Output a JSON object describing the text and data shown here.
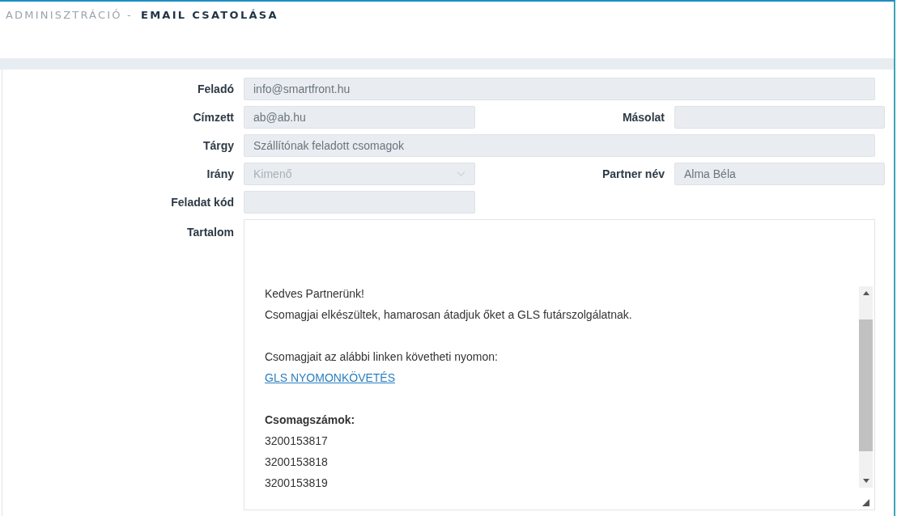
{
  "header": {
    "section": "ADMINISZTRÁCIÓ -",
    "title": "EMAIL CSATOLÁSA"
  },
  "rows": [
    {
      "kind": "wide",
      "fields": [
        {
          "kind": "text",
          "label": "Feladó",
          "value": "info@smartfront.hu"
        }
      ]
    },
    {
      "kind": "pair",
      "fields": [
        {
          "kind": "text",
          "label": "Címzett",
          "value": "ab@ab.hu"
        },
        {
          "kind": "text",
          "label": "Másolat"
        }
      ]
    },
    {
      "kind": "wide",
      "fields": [
        {
          "kind": "text",
          "label": "Tárgy",
          "value": "Szállítónak feladott csomagok"
        }
      ]
    },
    {
      "kind": "pair",
      "fields": [
        {
          "kind": "select",
          "label": "Irány",
          "value": "Kimenő",
          "disabled": true
        },
        {
          "kind": "text",
          "label": "Partner név",
          "value": "Alma Béla"
        }
      ]
    },
    {
      "kind": "pair",
      "fields": [
        {
          "kind": "text",
          "label": "Feladat kód"
        }
      ]
    }
  ],
  "content": {
    "label": "Tartalom",
    "blocks": [
      {
        "lines": [
          {
            "kind": "text",
            "text": "Kedves Partnerünk!"
          },
          {
            "kind": "text",
            "text": "Csomagjai elkészültek, hamarosan átadjuk őket a GLS futárszolgálatnak."
          }
        ]
      },
      {
        "lines": [
          {
            "kind": "text",
            "text": "Csomagjait az alábbi linken követheti nyomon:"
          },
          {
            "kind": "link",
            "text": "GLS NYOMONKÖVETÉS"
          }
        ]
      },
      {
        "lines": [
          {
            "kind": "bold",
            "text": "Csomagszámok:"
          },
          {
            "kind": "text",
            "text": "3200153817"
          },
          {
            "kind": "text",
            "text": "3200153818"
          },
          {
            "kind": "text",
            "text": "3200153819"
          }
        ]
      }
    ]
  }
}
